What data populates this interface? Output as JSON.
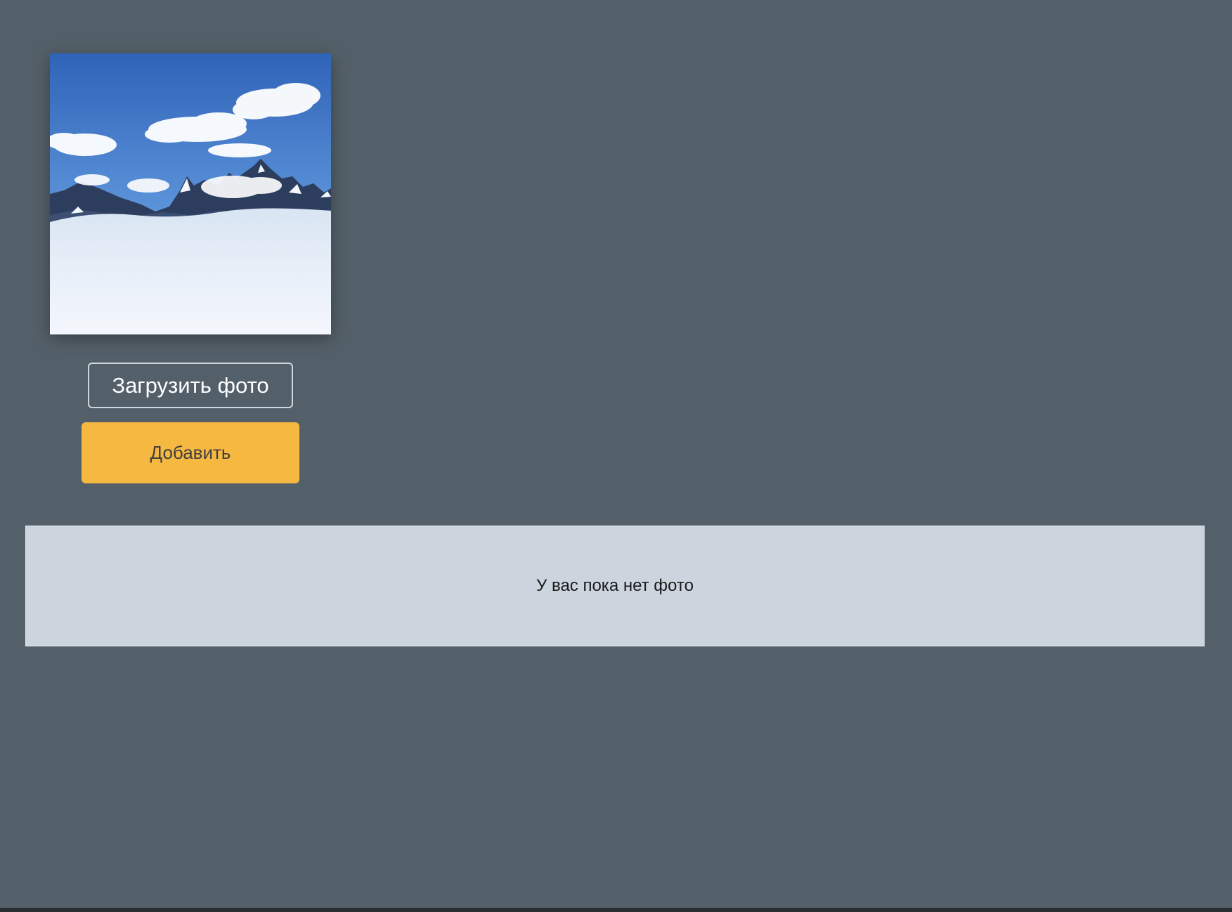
{
  "photo_preview": {
    "image": "mountains-above-clouds",
    "colors": {
      "sky_top": "#2f63b8",
      "sky_bottom": "#7fb0e6",
      "mountains": "#2c3d5e",
      "snow": "#f4f7fb",
      "cloud_sea": "#e8eff8"
    }
  },
  "upload": {
    "label": "Загрузить фото"
  },
  "add": {
    "label": "Добавить",
    "color": "#f5b841"
  },
  "gallery": {
    "empty_message": "У вас пока нет фото"
  },
  "theme": {
    "background": "#546069",
    "panel": "#ccd5de"
  }
}
